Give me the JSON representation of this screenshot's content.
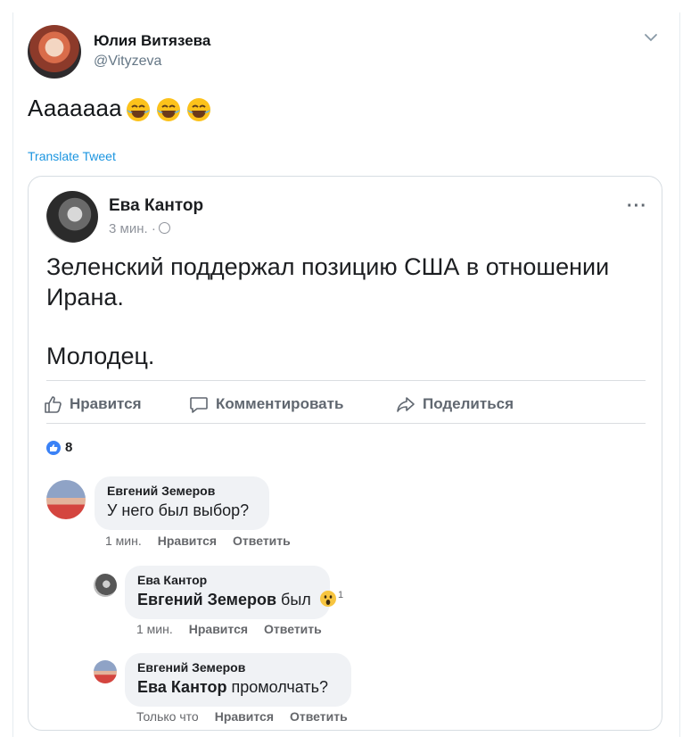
{
  "tweet": {
    "author_name": "Юлия Витязева",
    "author_handle": "@Vityzeva",
    "text": "Ааааааа",
    "emoji_count": 3,
    "translate_label": "Translate Tweet"
  },
  "post": {
    "author": "Ева Кантор",
    "time": "3 мин. ·",
    "text_line1": "Зеленский поддержал позицию США в отношении Ирана.",
    "text_line2": "Молодец.",
    "actions": {
      "like": "Нравится",
      "comment": "Комментировать",
      "share": "Поделиться"
    },
    "likes_count": "8"
  },
  "comments": [
    {
      "author": "Евгений Земеров",
      "text": "У него был выбор?",
      "time": "1 мин.",
      "like": "Нравится",
      "reply": "Ответить"
    },
    {
      "author": "Ева Кантор",
      "mention": "Евгений Земеров",
      "text": " был",
      "reaction_count": "1",
      "time": "1 мин.",
      "like": "Нравится",
      "reply": "Ответить"
    },
    {
      "author": "Евгений Земеров",
      "mention": "Ева Кантор",
      "text": " промолчать?",
      "time": "Только что",
      "like": "Нравится",
      "reply": "Ответить"
    }
  ],
  "colors": {
    "twitter_blue": "#1b95e0",
    "fb_grey": "#606770",
    "fb_like_blue": "#3b82f6"
  }
}
